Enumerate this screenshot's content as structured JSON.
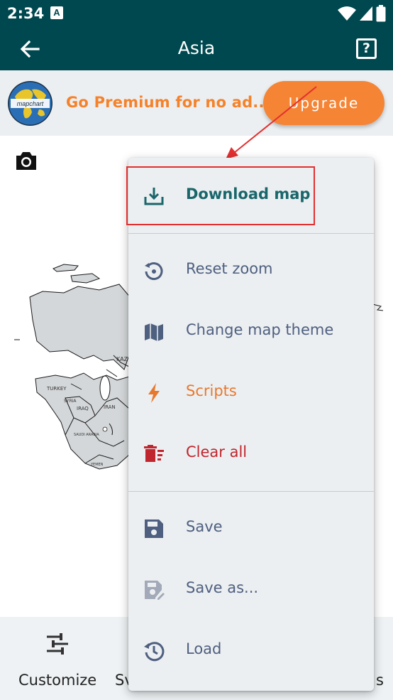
{
  "status_bar": {
    "time": "2:34",
    "notification_icon": "A"
  },
  "app_bar": {
    "title": "Asia",
    "back_icon": "arrow-left",
    "help_icon": "?"
  },
  "banner": {
    "text": "Go Premium for no ad...",
    "button": "Upgrade",
    "logo_text": "mapchart"
  },
  "map": {
    "labels": [
      "KAZ",
      "TURKEY",
      "SYRIA",
      "IRAQ",
      "IRAN",
      "SAUDI ARABIA",
      "YEMEN"
    ]
  },
  "menu": {
    "download": "Download map",
    "reset_zoom": "Reset zoom",
    "change_theme": "Change map theme",
    "scripts": "Scripts",
    "clear_all": "Clear all",
    "save": "Save",
    "save_as": "Save as...",
    "load": "Load"
  },
  "bottom_nav": {
    "customize": "Customize",
    "second_partial": "Sv",
    "third_partial": "s"
  },
  "colors": {
    "primary": "#00484f",
    "accent_orange": "#f58434",
    "menu_teal": "#19666b",
    "menu_slate": "#4e5f80",
    "scripts_orange": "#e8782e",
    "clear_red": "#c0262d",
    "annotation_red": "#e23030"
  }
}
